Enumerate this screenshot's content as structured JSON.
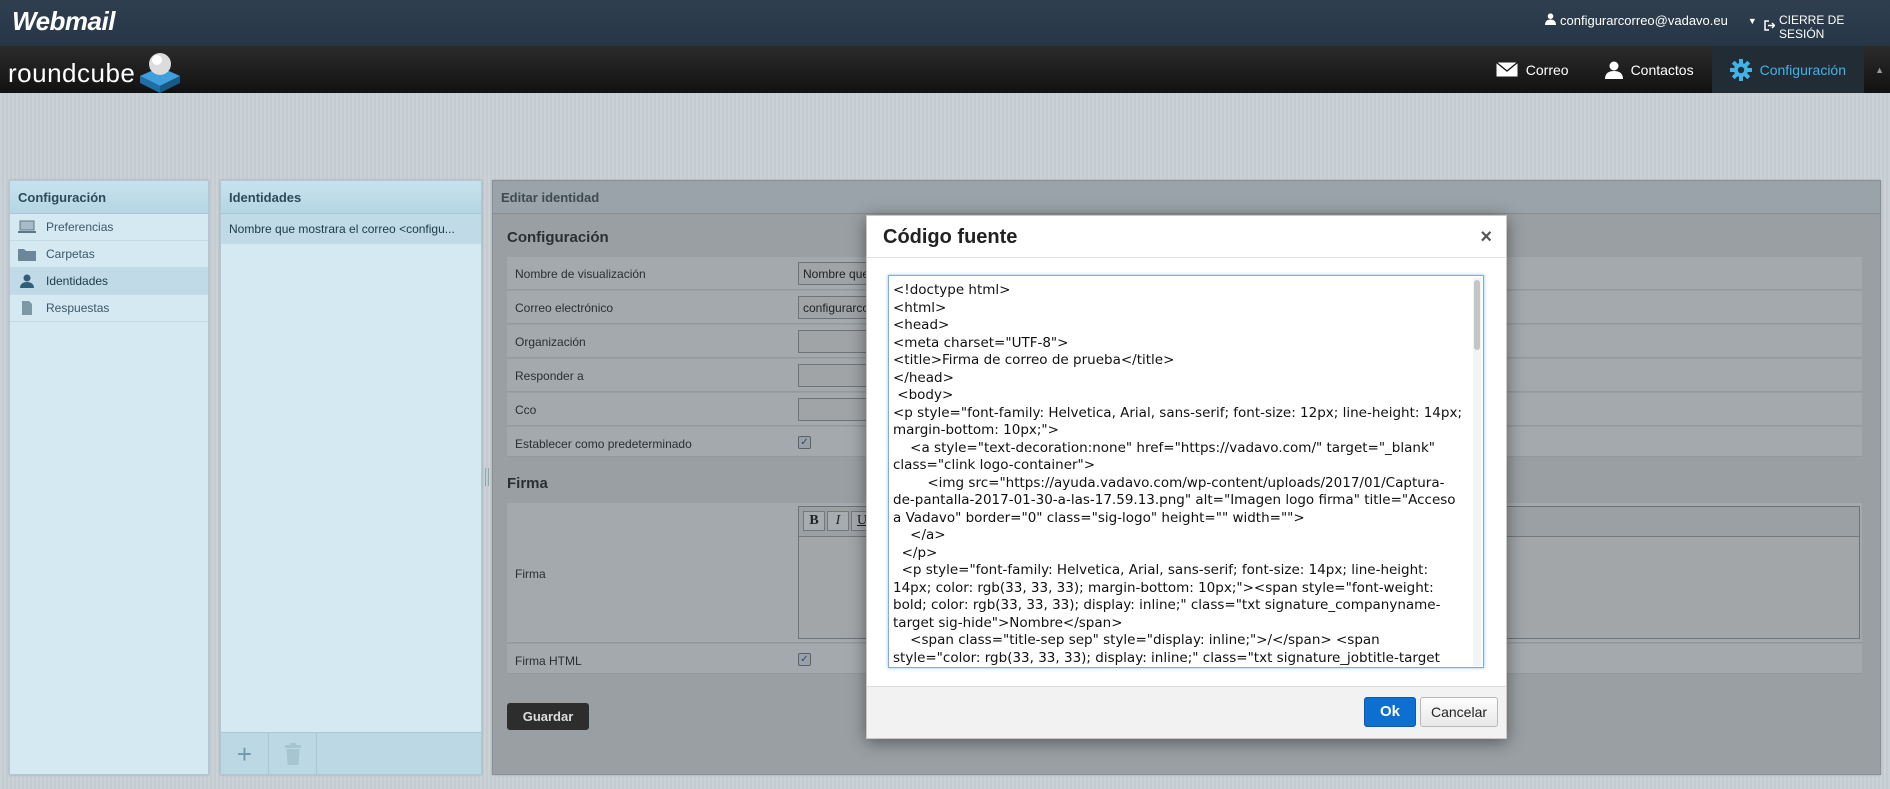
{
  "topbar": {
    "brand": "Webmail",
    "user_email": "configurarcorreo@vadavo.eu",
    "logout_label": "CIERRE DE SESIÓN"
  },
  "header": {
    "logo_text": "roundcube",
    "nav": [
      {
        "label": "Correo",
        "icon": "envelope-icon"
      },
      {
        "label": "Contactos",
        "icon": "person-icon"
      },
      {
        "label": "Configuración",
        "icon": "gear-icon",
        "active": true
      }
    ]
  },
  "settings_panel": {
    "title": "Configuración",
    "items": [
      {
        "label": "Preferencias",
        "icon": "laptop-icon"
      },
      {
        "label": "Carpetas",
        "icon": "folder-icon"
      },
      {
        "label": "Identidades",
        "icon": "person-icon",
        "selected": true
      },
      {
        "label": "Respuestas",
        "icon": "document-icon"
      }
    ]
  },
  "identities_panel": {
    "title": "Identidades",
    "items": [
      "Nombre que mostrara el correo <configu..."
    ],
    "add_icon": "plus-icon",
    "delete_icon": "trash-icon"
  },
  "edit_panel": {
    "title": "Editar identidad",
    "section_config": "Configuración",
    "fields": {
      "display_name_label": "Nombre de visualización",
      "display_name_value": "Nombre que m",
      "email_label": "Correo electrónico",
      "email_value": "configurarcorr",
      "organization_label": "Organización",
      "reply_to_label": "Responder a",
      "bcc_label": "Cco",
      "default_label": "Establecer como predeterminado"
    },
    "section_signature": "Firma",
    "signature_label": "Firma",
    "html_signature_label": "Firma HTML",
    "save_label": "Guardar",
    "toolbar": [
      "B",
      "I",
      "U"
    ]
  },
  "modal": {
    "title": "Código fuente",
    "close": "×",
    "code": "<!doctype html>\n<html>\n<head>\n<meta charset=\"UTF-8\">\n<title>Firma de correo de prueba</title>\n</head>\n <body>\n<p style=\"font-family: Helvetica, Arial, sans-serif; font-size: 12px; line-height: 14px; margin-bottom: 10px;\">\n    <a style=\"text-decoration:none\" href=\"https://vadavo.com/\" target=\"_blank\" class=\"clink logo-container\">\n        <img src=\"https://ayuda.vadavo.com/wp-content/uploads/2017/01/Captura-de-pantalla-2017-01-30-a-las-17.59.13.png\" alt=\"Imagen logo firma\" title=\"Acceso a Vadavo\" border=\"0\" class=\"sig-logo\" height=\"\" width=\"\">\n    </a>\n  </p>\n  <p style=\"font-family: Helvetica, Arial, sans-serif; font-size: 14px; line-height: 14px; color: rgb(33, 33, 33); margin-bottom: 10px;\"><span style=\"font-weight: bold; color: rgb(33, 33, 33); display: inline;\" class=\"txt signature_companyname-target sig-hide\">Nombre</span>\n    <span class=\"title-sep sep\" style=\"display: inline;\">/</span> <span style=\"color: rgb(33, 33, 33); display: inline;\" class=\"txt signature_jobtitle-target sig-hide\">A que te dedicas</span>",
    "ok_label": "Ok",
    "cancel_label": "Cancelar"
  }
}
